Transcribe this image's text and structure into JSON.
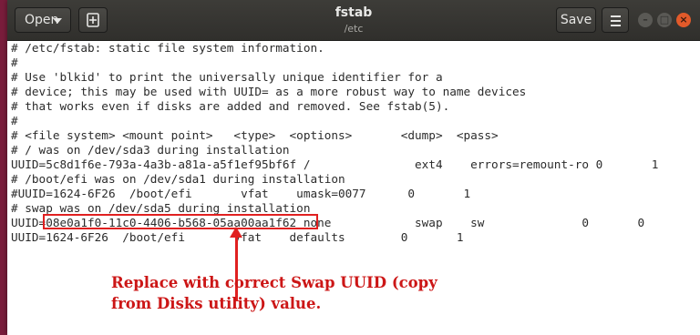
{
  "header": {
    "open_label": "Open",
    "title": "fstab",
    "subtitle": "/etc",
    "save_label": "Save"
  },
  "editor": {
    "lines": [
      "# /etc/fstab: static file system information.",
      "#",
      "# Use 'blkid' to print the universally unique identifier for a",
      "# device; this may be used with UUID= as a more robust way to name devices",
      "# that works even if disks are added and removed. See fstab(5).",
      "#",
      "# <file system> <mount point>   <type>  <options>       <dump>  <pass>",
      "# / was on /dev/sda3 during installation",
      "UUID=5c8d1f6e-793a-4a3b-a81a-a5f1ef95bf6f /               ext4    errors=remount-ro 0       1",
      "# /boot/efi was on /dev/sda1 during installation",
      "#UUID=1624-6F26  /boot/efi       vfat    umask=0077      0       1",
      "# swap was on /dev/sda5 during installation",
      "UUID=08e0a1f0-11c0-4406-b568-05aa00aa1f62 none            swap    sw              0       0",
      "UUID=1624-6F26  /boot/efi       vfat    defaults        0       1"
    ]
  },
  "annotation": {
    "text_line1": "Replace with correct Swap UUID (copy",
    "text_line2": "from Disks utility) value.",
    "color": "#cc1616"
  }
}
